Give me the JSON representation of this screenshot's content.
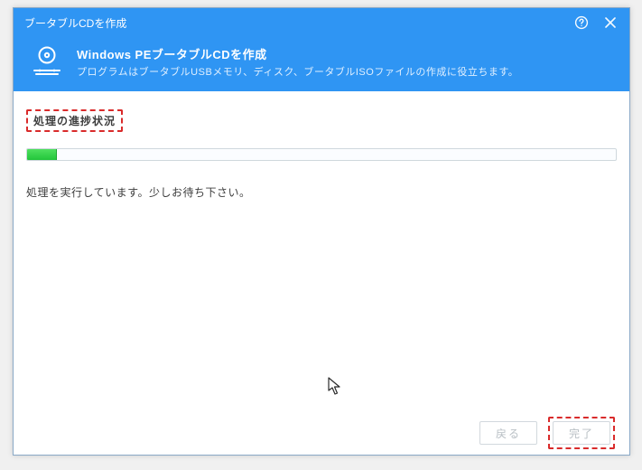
{
  "titlebar": {
    "title": "ブータブルCDを作成"
  },
  "header": {
    "title": "Windows PEブータブルCDを作成",
    "subtitle": "プログラムはブータブルUSBメモリ、ディスク、ブータブルISOファイルの作成に役立ちます。"
  },
  "body": {
    "section_title": "処理の進捗状況",
    "progress_percent": 5,
    "status": "処理を実行しています。少しお待ち下さい。"
  },
  "footer": {
    "back_label": "戻る",
    "finish_label": "完了"
  }
}
